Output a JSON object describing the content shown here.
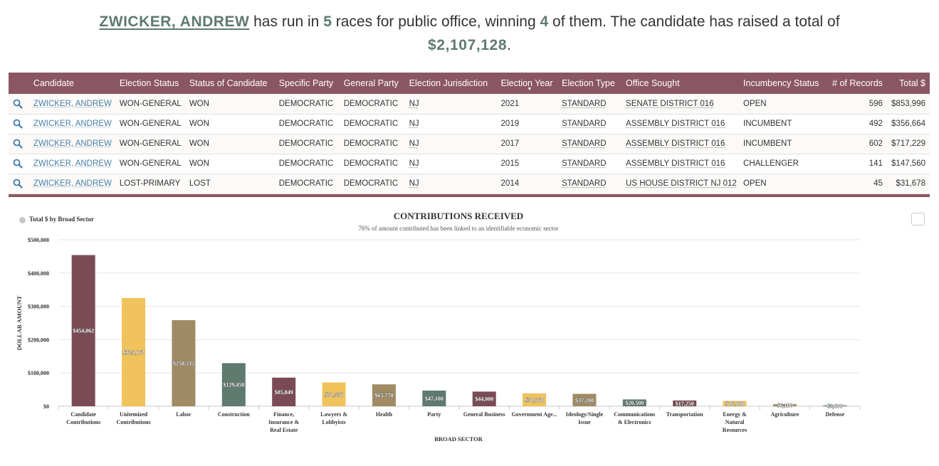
{
  "headline": {
    "name": "ZWICKER, ANDREW",
    "t1": " has run in ",
    "races": "5",
    "t2": " races for public office, winning ",
    "wins": "4",
    "t3": " of them. The candidate has raised a total of",
    "total": "$2,107,128",
    "t4": "."
  },
  "table": {
    "headers": [
      "Candidate",
      "Election Status",
      "Status of Candidate",
      "Specific Party",
      "General Party",
      "Election Jurisdiction",
      "Election Year",
      "Election Type",
      "Office Sought",
      "Incumbency Status",
      "# of Records",
      "Total $"
    ],
    "rows": [
      [
        "ZWICKER, ANDREW",
        "WON-GENERAL",
        "WON",
        "DEMOCRATIC",
        "DEMOCRATIC",
        "NJ",
        "2021",
        "STANDARD",
        "SENATE DISTRICT 016",
        "OPEN",
        "596",
        "$853,996"
      ],
      [
        "ZWICKER, ANDREW",
        "WON-GENERAL",
        "WON",
        "DEMOCRATIC",
        "DEMOCRATIC",
        "NJ",
        "2019",
        "STANDARD",
        "ASSEMBLY DISTRICT 016",
        "INCUMBENT",
        "492",
        "$356,664"
      ],
      [
        "ZWICKER, ANDREW",
        "WON-GENERAL",
        "WON",
        "DEMOCRATIC",
        "DEMOCRATIC",
        "NJ",
        "2017",
        "STANDARD",
        "ASSEMBLY DISTRICT 016",
        "INCUMBENT",
        "602",
        "$717,229"
      ],
      [
        "ZWICKER, ANDREW",
        "WON-GENERAL",
        "WON",
        "DEMOCRATIC",
        "DEMOCRATIC",
        "NJ",
        "2015",
        "STANDARD",
        "ASSEMBLY DISTRICT 016",
        "CHALLENGER",
        "141",
        "$147,560"
      ],
      [
        "ZWICKER, ANDREW",
        "LOST-PRIMARY",
        "LOST",
        "DEMOCRATIC",
        "DEMOCRATIC",
        "NJ",
        "2014",
        "STANDARD",
        "US HOUSE DISTRICT NJ 012",
        "OPEN",
        "45",
        "$31,678"
      ]
    ]
  },
  "icons": {
    "row_action": "magnifier-icon",
    "chart_menu": "menu-icon"
  },
  "colors": {
    "header": "#8b5663",
    "accent": "#5f7a6e",
    "link": "#4a7fa8"
  },
  "chart_data": {
    "type": "bar",
    "title": "CONTRIBUTIONS RECEIVED",
    "subtitle": "76% of amount contributed has been linked to an identifiable economic sector",
    "legend": "Total $ by Broad Sector",
    "legend_position": "top-left",
    "xlabel": "BROAD SECTOR",
    "ylabel": "DOLLAR AMOUNT",
    "ylim": [
      0,
      500000
    ],
    "y_ticks": [
      "$0",
      "$100,000",
      "$200,000",
      "$300,000",
      "$400,000",
      "$500,000"
    ],
    "grid": true,
    "categories": [
      [
        "Candidate",
        "Contributions"
      ],
      [
        "Unitemized",
        "Contributions"
      ],
      [
        "Labor"
      ],
      [
        "Construction"
      ],
      [
        "Finance,",
        "Insurance &",
        "Real Estate"
      ],
      [
        "Lawyers &",
        "Lobbyists"
      ],
      [
        "Health"
      ],
      [
        "Party"
      ],
      [
        "General Business"
      ],
      [
        "Government Age..."
      ],
      [
        "Ideology/Single",
        "Issue"
      ],
      [
        "Communications",
        "& Electronics"
      ],
      [
        "Transportation"
      ],
      [
        "Energy &",
        "Natural",
        "Resources"
      ],
      [
        "Agriculture"
      ],
      [
        "Defense"
      ]
    ],
    "values": [
      454062,
      325172,
      258535,
      129450,
      85849,
      71556,
      65770,
      47100,
      44000,
      38760,
      37200,
      20500,
      17250,
      16100,
      6100,
      2600
    ],
    "value_labels": [
      "$454,062",
      "$325,172",
      "$258,535",
      "$129,450",
      "$85,849",
      "$71,556",
      "$65,770",
      "$47,100",
      "$44,000",
      "$38,760",
      "$37,200",
      "$20,500",
      "$17,250",
      "$16,100",
      "$6,100",
      "$2,600"
    ],
    "bar_colors": [
      "#7b4b55",
      "#f0c35c",
      "#a18b64",
      "#5f7a6e",
      "#7b4b55",
      "#f0c35c",
      "#a18b64",
      "#5f7a6e",
      "#7b4b55",
      "#f0c35c",
      "#a18b64",
      "#5f7a6e",
      "#7b4b55",
      "#f0c35c",
      "#a18b64",
      "#5f7a6e"
    ]
  }
}
